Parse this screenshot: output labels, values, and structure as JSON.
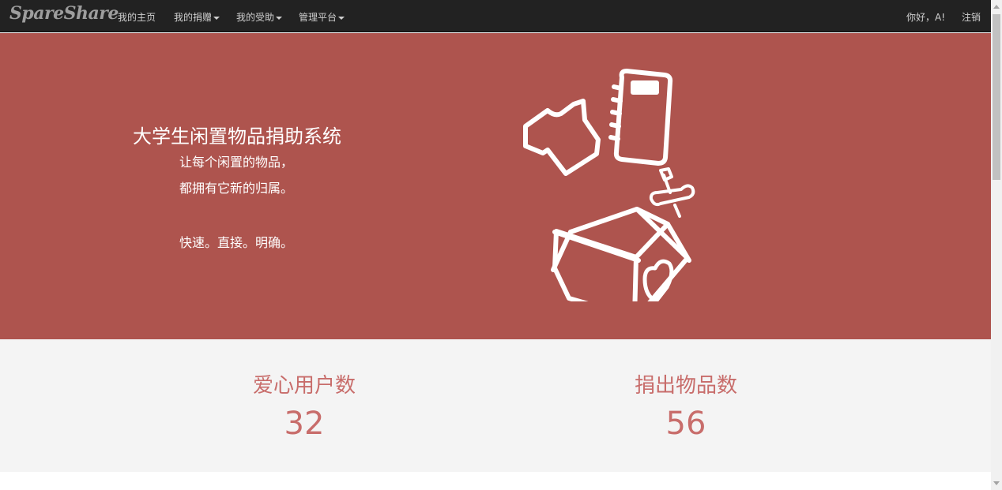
{
  "navbar": {
    "brand": "SpareShare",
    "items": [
      {
        "label": "我的主页",
        "dropdown": false
      },
      {
        "label": "我的捐赠",
        "dropdown": true
      },
      {
        "label": "我的受助",
        "dropdown": true
      },
      {
        "label": "管理平台",
        "dropdown": true
      }
    ],
    "greeting": "你好，A!",
    "logout": "注销"
  },
  "hero": {
    "title": "大学生闲置物品捐助系统",
    "line1": "让每个闲置的物品，",
    "line2": "都拥有它新的归属。",
    "line3": "快速。直接。明确。",
    "illustration": [
      "shirt-icon",
      "notebook-icon",
      "tools-icon",
      "heart-box-icon"
    ]
  },
  "stats": [
    {
      "label": "爱心用户数",
      "value": "32"
    },
    {
      "label": "捐出物品数",
      "value": "56"
    }
  ],
  "colors": {
    "navbar_bg": "#222222",
    "hero_bg": "#ae544e",
    "stats_bg": "#f4f4f4",
    "stat_text": "#c86d6b"
  }
}
